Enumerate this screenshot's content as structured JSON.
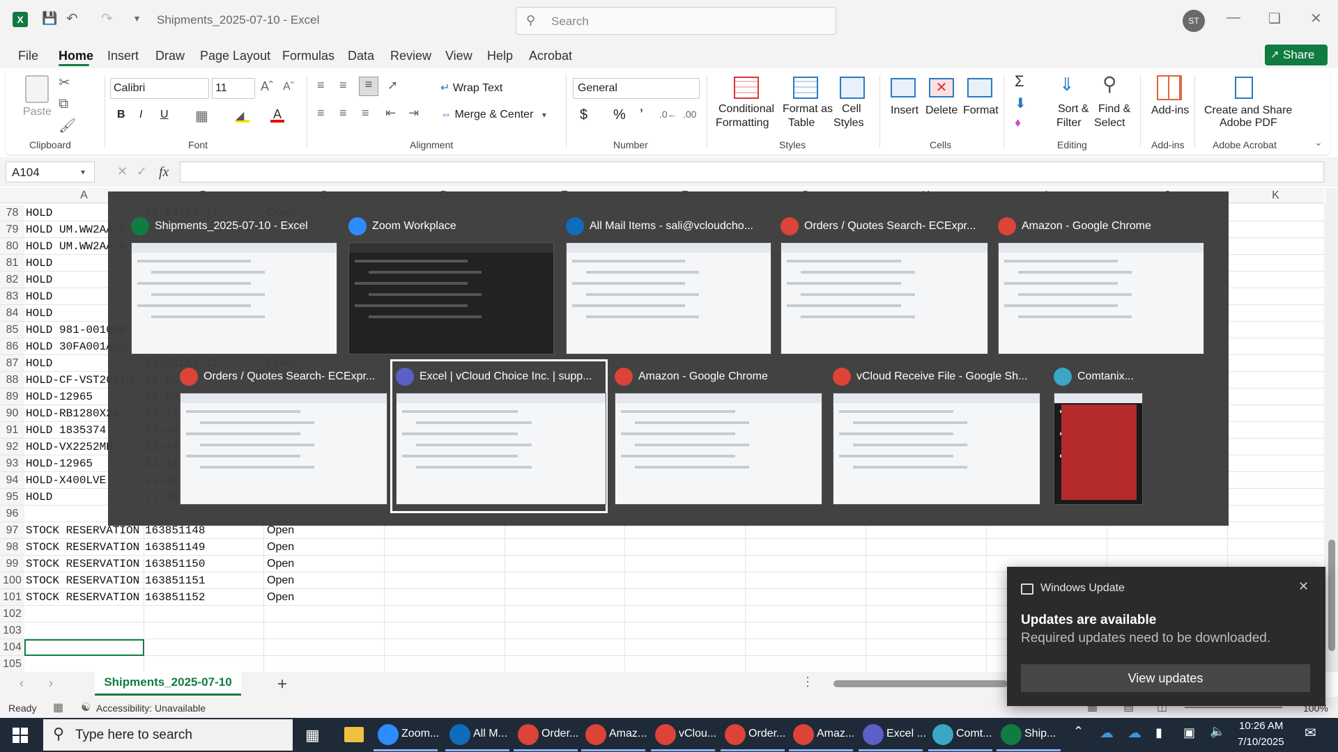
{
  "titlebar": {
    "doc_title": "Shipments_2025-07-10  -  Excel",
    "search_placeholder": "Search",
    "avatar_initials": "ST"
  },
  "menu": {
    "tabs": [
      "File",
      "Home",
      "Insert",
      "Draw",
      "Page Layout",
      "Formulas",
      "Data",
      "Review",
      "View",
      "Help",
      "Acrobat"
    ],
    "active": "Home",
    "share_label": "Share"
  },
  "ribbon": {
    "clipboard": {
      "group": "Clipboard",
      "paste": "Paste"
    },
    "font": {
      "group": "Font",
      "name": "Calibri",
      "size": "11"
    },
    "alignment": {
      "group": "Alignment",
      "wrap": "Wrap Text",
      "merge": "Merge & Center"
    },
    "number": {
      "group": "Number",
      "format": "General"
    },
    "styles": {
      "group": "Styles",
      "cond1": "Conditional",
      "cond2": "Formatting",
      "fat1": "Format as",
      "fat2": "Table",
      "cs1": "Cell",
      "cs2": "Styles"
    },
    "cells": {
      "group": "Cells",
      "insert": "Insert",
      "delete": "Delete",
      "format": "Format"
    },
    "editing": {
      "group": "Editing",
      "sf1": "Sort &",
      "sf2": "Filter",
      "fs1": "Find &",
      "fs2": "Select"
    },
    "addins": {
      "group": "Add-ins",
      "label": "Add-ins"
    },
    "acrobat": {
      "group": "Adobe Acrobat",
      "l1": "Create and Share",
      "l2": "Adobe PDF"
    }
  },
  "formula_bar": {
    "name_box": "A104",
    "fx": "fx",
    "value": ""
  },
  "columns": [
    "A",
    "B",
    "C",
    "D",
    "E",
    "F",
    "G",
    "H",
    "I",
    "J",
    "K"
  ],
  "rows": [
    {
      "n": "78",
      "a": "HOLD",
      "b": "21-64167-11",
      "c": "Open"
    },
    {
      "n": "79",
      "a": "HOLD UM.WW2AA.0",
      "b": "",
      "c": ""
    },
    {
      "n": "80",
      "a": "HOLD UM.WW2AA.0",
      "b": "",
      "c": ""
    },
    {
      "n": "81",
      "a": "HOLD",
      "b": "",
      "c": ""
    },
    {
      "n": "82",
      "a": "HOLD",
      "b": "",
      "c": ""
    },
    {
      "n": "83",
      "a": "HOLD",
      "b": "",
      "c": ""
    },
    {
      "n": "84",
      "a": "HOLD",
      "b": "",
      "c": ""
    },
    {
      "n": "85",
      "a": "HOLD 981-001008",
      "b": "",
      "c": ""
    },
    {
      "n": "86",
      "a": "HOLD 30FA001AUS",
      "b": "",
      "c": ""
    },
    {
      "n": "87",
      "a": "HOLD",
      "b": "21-53184-11",
      "c": "Open"
    },
    {
      "n": "88",
      "a": "HOLD-CF-VST2011U",
      "b": "21-504",
      "c": ""
    },
    {
      "n": "89",
      "a": "HOLD-12965",
      "b": "21-503",
      "c": ""
    },
    {
      "n": "90",
      "a": "HOLD-RB1280X2A",
      "b": "21-478",
      "c": ""
    },
    {
      "n": "91",
      "a": "HOLD 1835374",
      "b": "21-466",
      "c": ""
    },
    {
      "n": "92",
      "a": "HOLD-VX2252MH",
      "b": "21-447",
      "c": ""
    },
    {
      "n": "93",
      "a": "HOLD-12965",
      "b": "21-417",
      "c": ""
    },
    {
      "n": "94",
      "a": "HOLD-X400LVE",
      "b": "21-402",
      "c": ""
    },
    {
      "n": "95",
      "a": "HOLD",
      "b": "21-387",
      "c": ""
    },
    {
      "n": "96",
      "a": "",
      "b": "",
      "c": ""
    },
    {
      "n": "97",
      "a": "STOCK RESERVATION",
      "b": "163851148",
      "c": "Open"
    },
    {
      "n": "98",
      "a": "STOCK RESERVATION",
      "b": "163851149",
      "c": "Open"
    },
    {
      "n": "99",
      "a": "STOCK RESERVATION",
      "b": "163851150",
      "c": "Open"
    },
    {
      "n": "100",
      "a": "STOCK RESERVATION",
      "b": "163851151",
      "c": "Open"
    },
    {
      "n": "101",
      "a": "STOCK RESERVATION",
      "b": "163851152",
      "c": "Open"
    },
    {
      "n": "102",
      "a": "",
      "b": "",
      "c": ""
    },
    {
      "n": "103",
      "a": "",
      "b": "",
      "c": ""
    },
    {
      "n": "104",
      "a": "",
      "b": "",
      "c": ""
    },
    {
      "n": "105",
      "a": "",
      "b": "",
      "c": ""
    }
  ],
  "task_view": {
    "windows": [
      {
        "title": "Shipments_2025-07-10 - Excel",
        "app": "excel-icon",
        "color": "#107c41"
      },
      {
        "title": "Zoom Workplace",
        "app": "zoom-icon",
        "color": "#2d8cff"
      },
      {
        "title": "All Mail Items - sali@vcloudcho...",
        "app": "outlook-icon",
        "color": "#0f6cbd"
      },
      {
        "title": "Orders / Quotes Search- ECExpr...",
        "app": "chrome-icon",
        "color": "#db4437"
      },
      {
        "title": "Amazon - Google Chrome",
        "app": "chrome-icon",
        "color": "#db4437"
      },
      {
        "title": "Orders / Quotes Search- ECExpr...",
        "app": "chrome-icon",
        "color": "#db4437"
      },
      {
        "title": "Excel | vCloud Choice Inc. | supp...",
        "app": "teams-icon",
        "color": "#5b5fc7"
      },
      {
        "title": "Amazon - Google Chrome",
        "app": "chrome-icon",
        "color": "#db4437"
      },
      {
        "title": "vCloud Receive File - Google Sh...",
        "app": "chrome-icon",
        "color": "#db4437"
      },
      {
        "title": "Comtanix...",
        "app": "comtanix-icon",
        "color": "#3aa7c4"
      }
    ],
    "selected_index": 6
  },
  "sheet": {
    "tab": "Shipments_2025-07-10",
    "add": "+"
  },
  "status": {
    "ready": "Ready",
    "accessibility": "Accessibility: Unavailable",
    "zoom": "100%"
  },
  "notification": {
    "app": "Windows Update",
    "title": "Updates are available",
    "body": "Required updates need to be downloaded.",
    "button": "View updates"
  },
  "taskbar": {
    "search_placeholder": "Type here to search",
    "apps": [
      "Zoom...",
      "All M...",
      "Order...",
      "Amaz...",
      "vClou...",
      "Order...",
      "Amaz...",
      "Excel ...",
      "Comt...",
      "Ship..."
    ],
    "time": "10:26 AM",
    "date": "7/10/2025"
  }
}
